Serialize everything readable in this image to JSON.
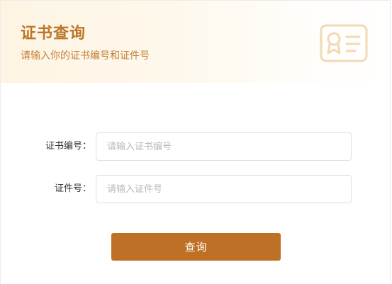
{
  "header": {
    "title": "证书查询",
    "subtitle": "请输入你的证书编号和证件号",
    "icon": "certificate-icon"
  },
  "form": {
    "cert_no": {
      "label": "证书编号：",
      "placeholder": "请输入证书编号",
      "value": ""
    },
    "id_no": {
      "label": "证件号：",
      "placeholder": "请输入证件号",
      "value": ""
    },
    "submit_label": "查询"
  },
  "colors": {
    "accent": "#bf7027",
    "title": "#bd7628",
    "header_bg": "#fdf4e3",
    "icon": "#f2d9b6"
  }
}
